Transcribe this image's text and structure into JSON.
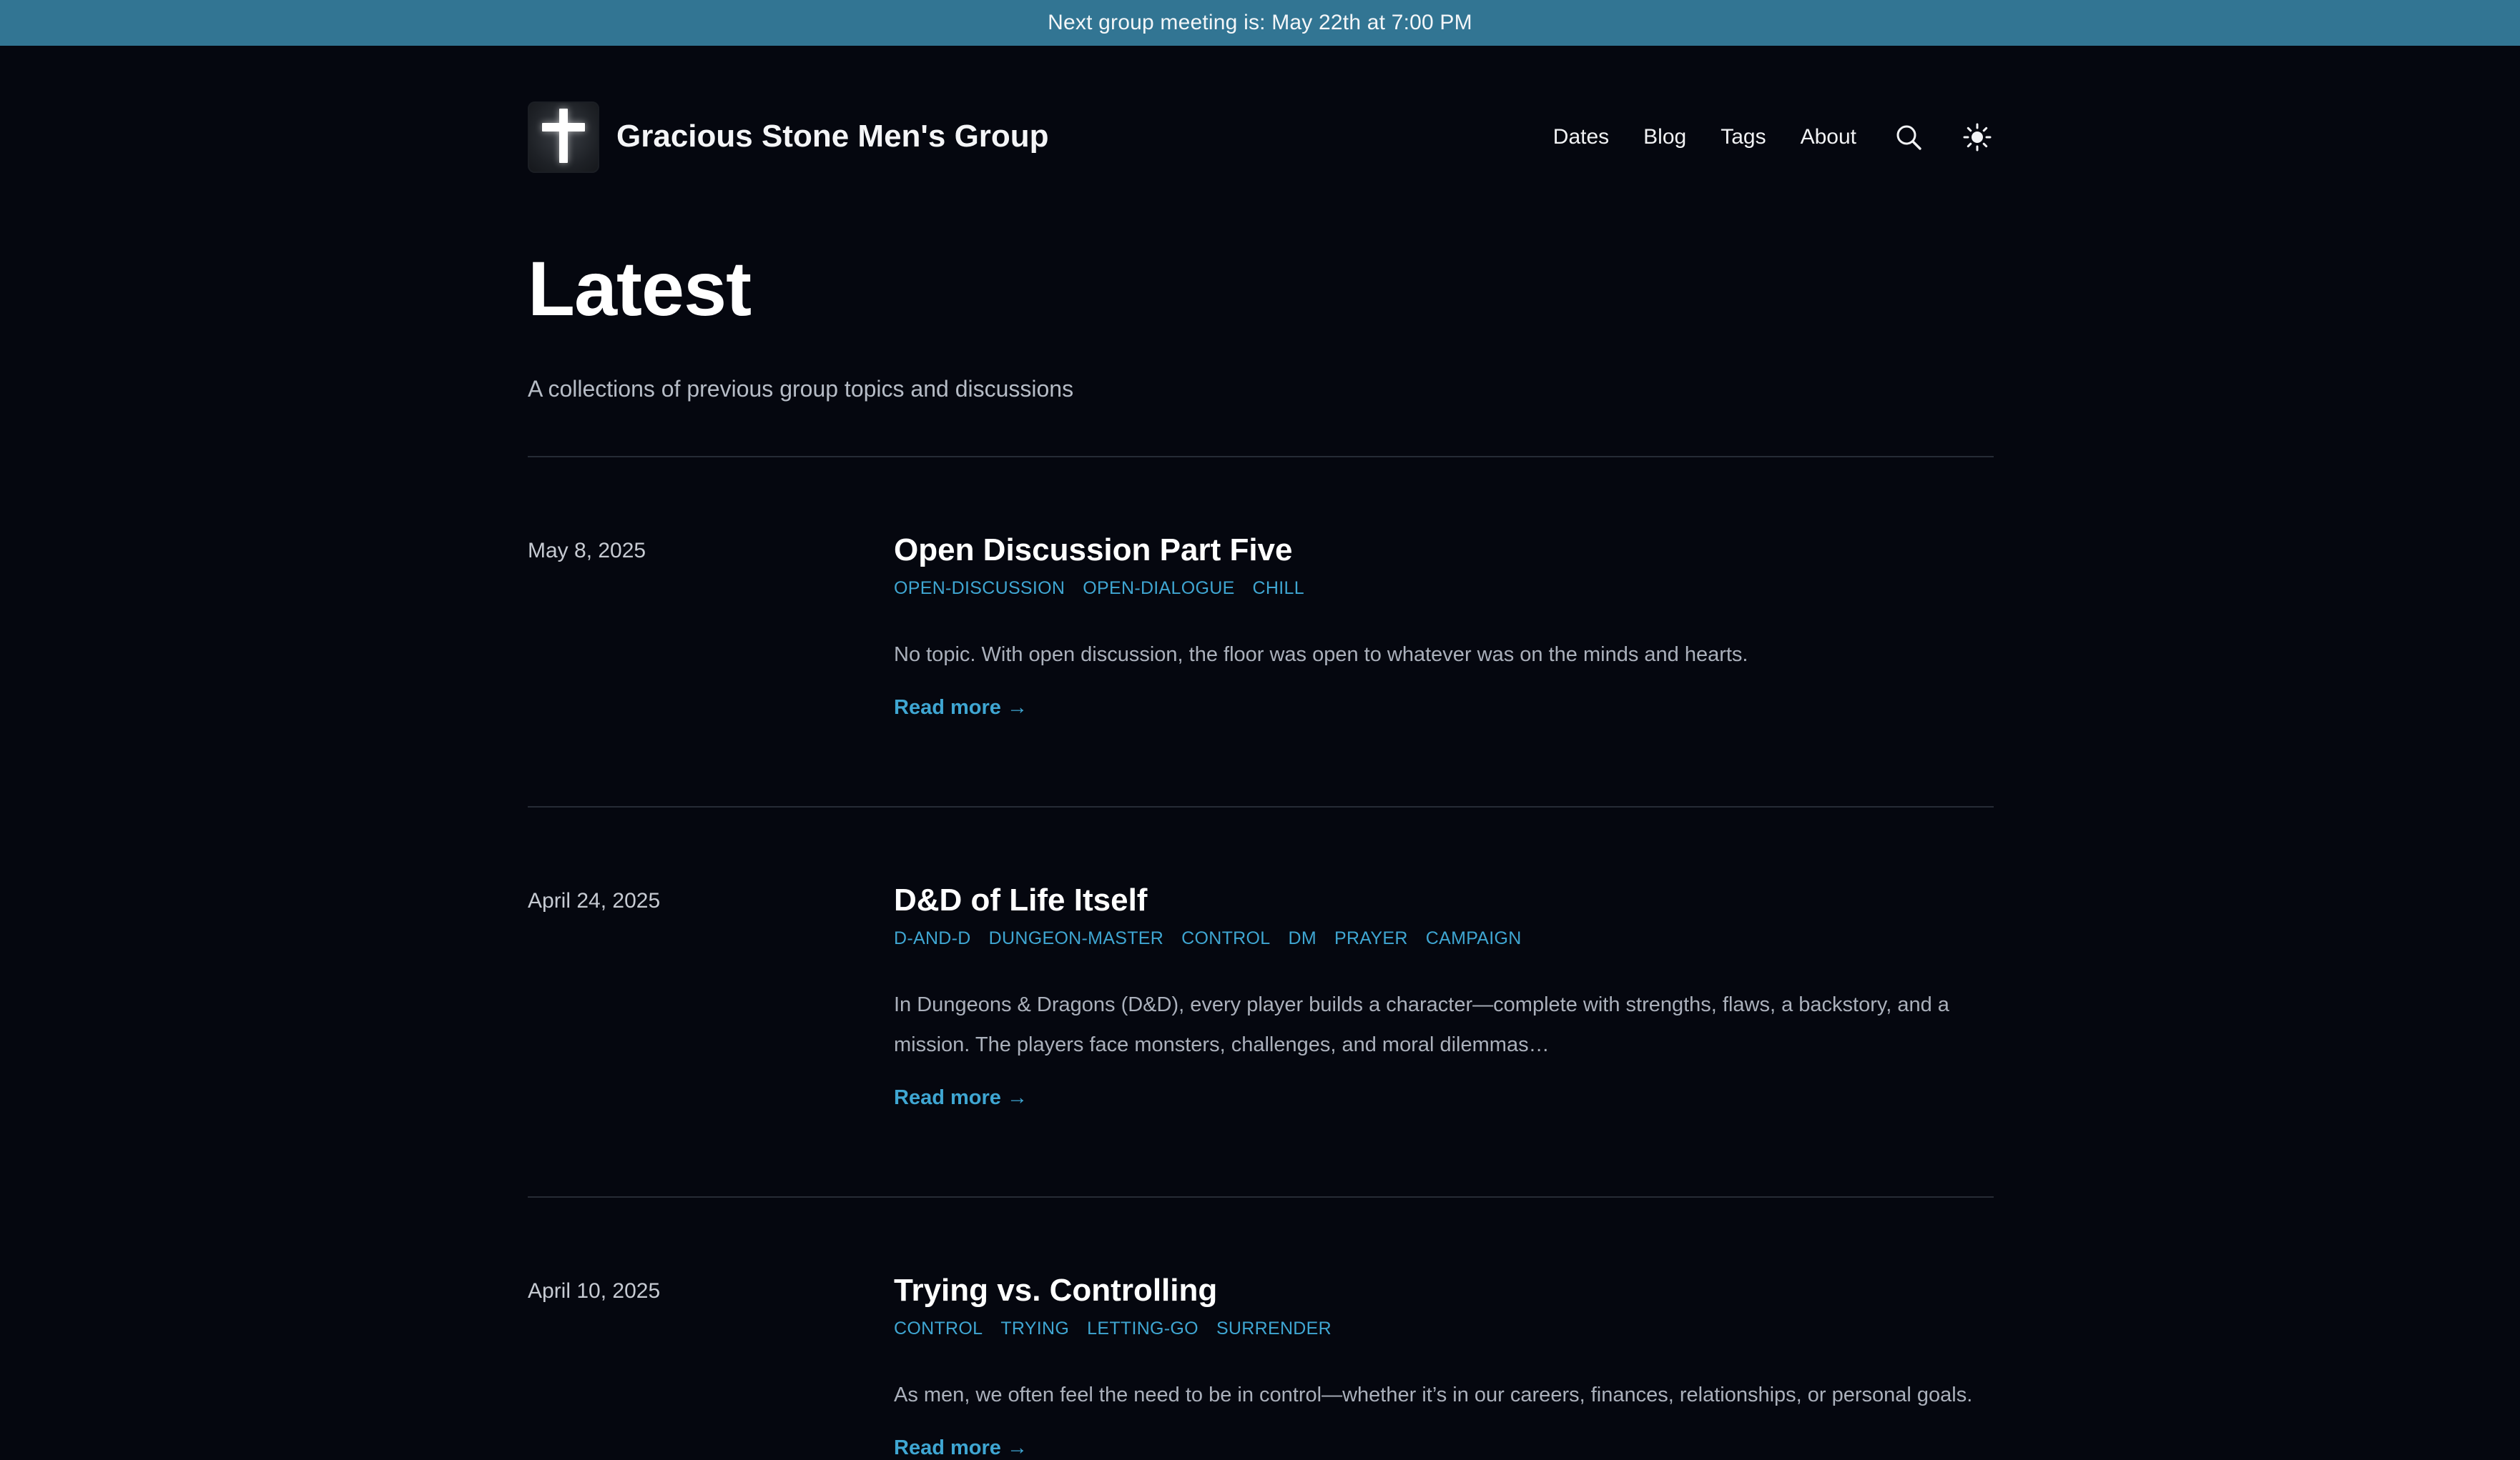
{
  "banner": {
    "text": "Next group meeting is: May 22th at 7:00 PM"
  },
  "header": {
    "site_title": "Gracious Stone Men's Group",
    "nav": [
      {
        "label": "Dates"
      },
      {
        "label": "Blog"
      },
      {
        "label": "Tags"
      },
      {
        "label": "About"
      }
    ],
    "icons": {
      "search": "search-icon",
      "theme": "sun-icon"
    }
  },
  "main": {
    "title": "Latest",
    "description": "A collections of previous group topics and discussions",
    "posts": [
      {
        "date": "May 8, 2025",
        "title": "Open Discussion Part Five",
        "tags": [
          "OPEN-DISCUSSION",
          "OPEN-DIALOGUE",
          "CHILL"
        ],
        "excerpt": "No topic. With open discussion, the floor was open to whatever was on the minds and hearts.",
        "read_more": "Read more →"
      },
      {
        "date": "April 24, 2025",
        "title": "D&D of Life Itself",
        "tags": [
          "D-AND-D",
          "DUNGEON-MASTER",
          "CONTROL",
          "DM",
          "PRAYER",
          "CAMPAIGN"
        ],
        "excerpt": "In Dungeons & Dragons (D&D), every player builds a character—complete with strengths, flaws, a backstory, and a mission. The players face monsters, challenges, and moral dilemmas…",
        "read_more": "Read more →"
      },
      {
        "date": "April 10, 2025",
        "title": "Trying vs. Controlling",
        "tags": [
          "CONTROL",
          "TRYING",
          "LETTING-GO",
          "SURRENDER"
        ],
        "excerpt": "As men, we often feel the need to be in control—whether it’s in our careers, finances, relationships, or personal goals.",
        "read_more": "Read more →"
      }
    ]
  },
  "colors": {
    "background": "#05070f",
    "banner": "#327593",
    "accent": "#3fa6d2"
  }
}
